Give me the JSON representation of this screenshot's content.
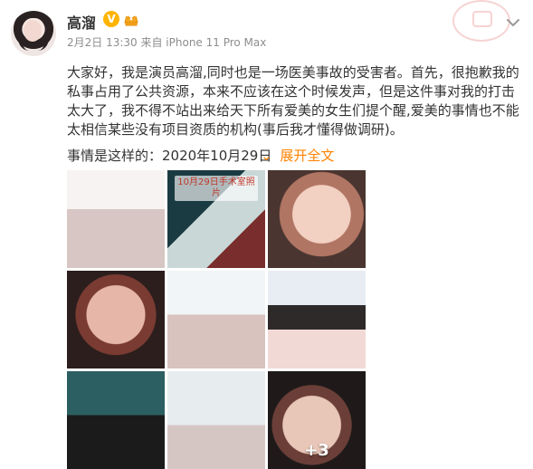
{
  "header": {
    "username": "高溜",
    "vip_badge_text": "V",
    "meta": "2月2日 13:30 来自 iPhone 11 Pro Max"
  },
  "post": {
    "paragraph": "大家好，我是演员高溜,同时也是一场医美事故的受害者。首先，很抱歉我的私事占用了公共资源，本来不应该在这个时候发声，但是这件事对我的打击太大了，我不得不站出来给天下所有爱美的女生们提个醒,爱美的事情也不能太相信某些没有项目资质的机构(事后我才懂得做调研)。",
    "date_line": "事情是这样的：2020年10月29日",
    "expand_label": "展开全文",
    "expand_chevron": "⌄"
  },
  "images": {
    "thumb1_caption": "",
    "thumb2_caption_top": "10月29日手术室照片",
    "thumb2_caption_bottom": "",
    "thumb3_caption": "",
    "more_count": "+3"
  },
  "icons": {
    "menu": "chevron-down-icon",
    "crown": "crown-icon",
    "stamp": "stamp-icon"
  },
  "colors": {
    "accent_orange": "#ff8200",
    "vip_gold": "#ffb400"
  }
}
